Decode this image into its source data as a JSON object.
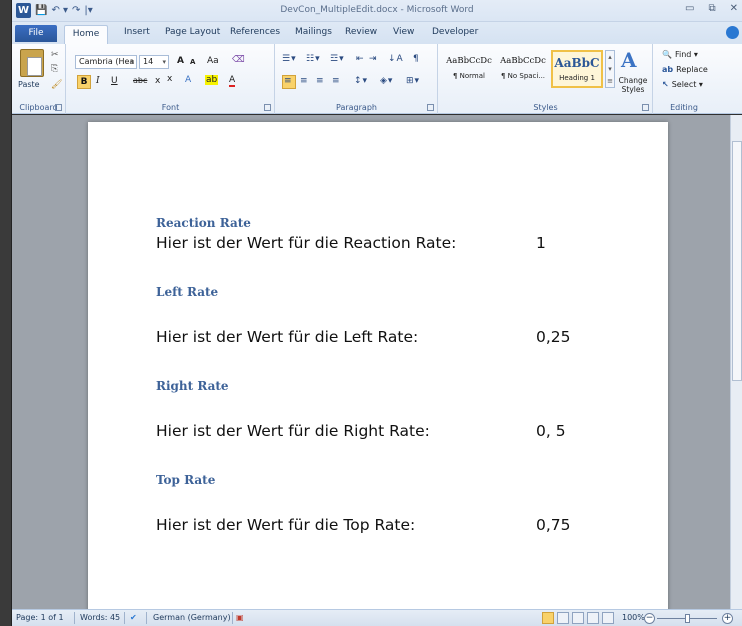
{
  "window": {
    "title": "DevCon_MultipleEdit.docx - Microsoft Word",
    "app_icon": "W",
    "controls": [
      "minimize-icon",
      "restore-icon",
      "close-icon"
    ]
  },
  "quick_access": [
    "save-icon",
    "undo-icon",
    "redo-icon",
    "customize-icon"
  ],
  "tabs": [
    "File",
    "Home",
    "Insert",
    "Page Layout",
    "References",
    "Mailings",
    "Review",
    "View",
    "Developer"
  ],
  "active_tab": "Home",
  "ribbon": {
    "clipboard": {
      "label": "Clipboard",
      "paste": "Paste"
    },
    "font": {
      "label": "Font",
      "font_name": "Cambria (Hea",
      "font_size": "14",
      "bold": "B",
      "italic": "I",
      "underline": "U",
      "strike": "abc",
      "subscript": "x",
      "superscript": "x",
      "grow": "A",
      "shrink": "A",
      "case": "Aa"
    },
    "paragraph": {
      "label": "Paragraph",
      "show_marks": "¶"
    },
    "styles": {
      "label": "Styles",
      "items": [
        {
          "sample": "AaBbCcDc",
          "name": "¶ Normal"
        },
        {
          "sample": "AaBbCcDc",
          "name": "¶ No Spaci..."
        },
        {
          "sample": "AaBbC",
          "name": "Heading 1"
        }
      ],
      "change_styles": "Change Styles"
    },
    "editing": {
      "label": "Editing",
      "find": "Find",
      "replace": "Replace",
      "select": "Select"
    }
  },
  "document": {
    "sections": [
      {
        "heading": "Reaction Rate",
        "text": "Hier ist der Wert für die Reaction Rate:",
        "value": "1"
      },
      {
        "heading": "Left Rate",
        "text": "Hier ist der Wert für die Left Rate:",
        "value": "0,25"
      },
      {
        "heading": "Right Rate",
        "text": "Hier ist der Wert für die Right Rate:",
        "value": "0, 5"
      },
      {
        "heading": "Top Rate",
        "text": "Hier ist der Wert für die Top Rate:",
        "value": "0,75"
      }
    ]
  },
  "status": {
    "page": "Page: 1 of 1",
    "words": "Words: 45",
    "language": "German (Germany)",
    "zoom": "100%"
  },
  "colors": {
    "heading": "#3d6298",
    "file_tab": "#2a5699",
    "highlight": "#f9d26a"
  }
}
